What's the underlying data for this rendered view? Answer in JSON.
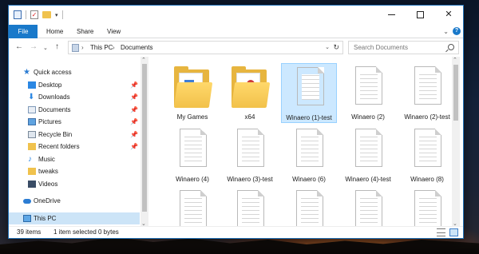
{
  "ribbon": {
    "tabs": [
      {
        "label": "File"
      },
      {
        "label": "Home"
      },
      {
        "label": "Share"
      },
      {
        "label": "View"
      }
    ]
  },
  "window_controls": {
    "close_glyph": "✕"
  },
  "address": {
    "path": [
      "This PC",
      "Documents"
    ],
    "separator": "›"
  },
  "search": {
    "placeholder": "Search Documents"
  },
  "nav_pane": {
    "items": [
      {
        "label": "Quick access",
        "icon": "star-icon"
      },
      {
        "label": "Desktop",
        "icon": "desktop-icon"
      },
      {
        "label": "Downloads",
        "icon": "download-icon"
      },
      {
        "label": "Documents",
        "icon": "documents-icon"
      },
      {
        "label": "Pictures",
        "icon": "pictures-icon"
      },
      {
        "label": "Recycle Bin",
        "icon": "recycle-bin-icon"
      },
      {
        "label": "Recent folders",
        "icon": "recent-folders-icon"
      },
      {
        "label": "Music",
        "icon": "music-icon"
      },
      {
        "label": "tweaks",
        "icon": "folder-icon"
      },
      {
        "label": "Videos",
        "icon": "videos-icon"
      },
      {
        "label": "OneDrive",
        "icon": "onedrive-icon"
      },
      {
        "label": "This PC",
        "icon": "computer-icon"
      }
    ],
    "pin_glyph": "📌"
  },
  "files": [
    {
      "name": "My Games",
      "type": "folder"
    },
    {
      "name": "x64",
      "type": "folder"
    },
    {
      "name": "Winaero (1)-test",
      "type": "document",
      "selected": true
    },
    {
      "name": "Winaero (2)",
      "type": "document"
    },
    {
      "name": "Winaero (2)-test",
      "type": "document"
    },
    {
      "name": "Winaero (4)",
      "type": "document"
    },
    {
      "name": "Winaero (3)-test",
      "type": "document"
    },
    {
      "name": "Winaero (6)",
      "type": "document"
    },
    {
      "name": "Winaero (4)-test",
      "type": "document"
    },
    {
      "name": "Winaero (8)",
      "type": "document"
    },
    {
      "name": "",
      "type": "document"
    },
    {
      "name": "",
      "type": "document"
    },
    {
      "name": "",
      "type": "document"
    },
    {
      "name": "",
      "type": "document"
    },
    {
      "name": "",
      "type": "document"
    }
  ],
  "status": {
    "item_count": "39 items",
    "selection": "1 item selected",
    "size": "0 bytes"
  }
}
